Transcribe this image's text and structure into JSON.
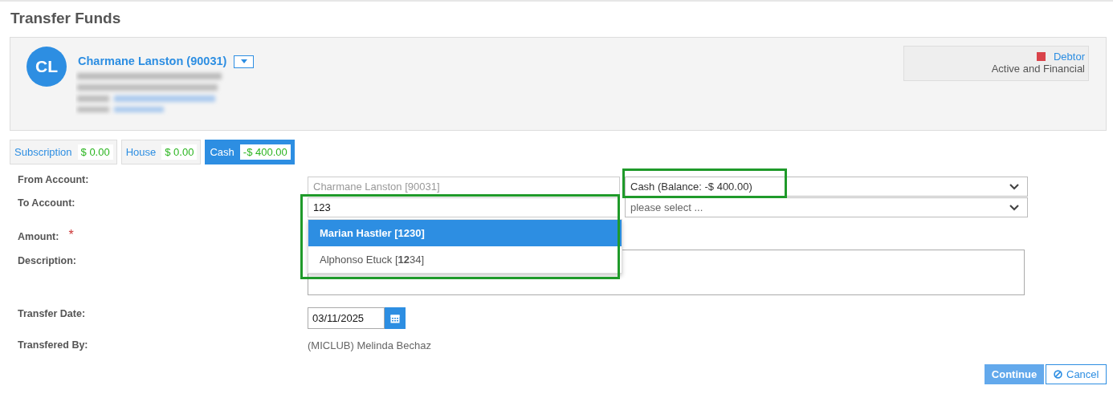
{
  "page": {
    "title": "Transfer Funds"
  },
  "member": {
    "initials": "CL",
    "name": "Charmane Lanston (90031)",
    "status": {
      "color": "#d9434a",
      "label": "Debtor",
      "text": "Active and Financial"
    }
  },
  "accounts": [
    {
      "label": "Subscription",
      "amount": "$ 0.00",
      "selected": false
    },
    {
      "label": "House",
      "amount": "$ 0.00",
      "selected": false
    },
    {
      "label": "Cash",
      "amount": "-$ 400.00",
      "selected": true
    }
  ],
  "form": {
    "from_label": "From Account:",
    "from_member": "Charmane Lanston [90031]",
    "from_account": "Cash (Balance: -$ 400.00)",
    "from_account_highlighted": true,
    "to_label": "To Account:",
    "to_search": "123",
    "to_search_highlighted": true,
    "to_account_placeholder": "please select ...",
    "suggestions": [
      {
        "text": "Marian Hastler [**12**30]",
        "selected": true
      },
      {
        "text": "Alphonso Etuck [**12**34]",
        "selected": false
      }
    ],
    "amount_label": "Amount:",
    "amount_required_mark": "*",
    "description_label": "Description:",
    "date_label": "Transfer Date:",
    "date": "03/11/2025",
    "by_label": "Transfered By:",
    "by_value": "(MICLUB) Melinda Bechaz"
  },
  "buttons": {
    "continue": "Continue",
    "cancel": "Cancel"
  }
}
